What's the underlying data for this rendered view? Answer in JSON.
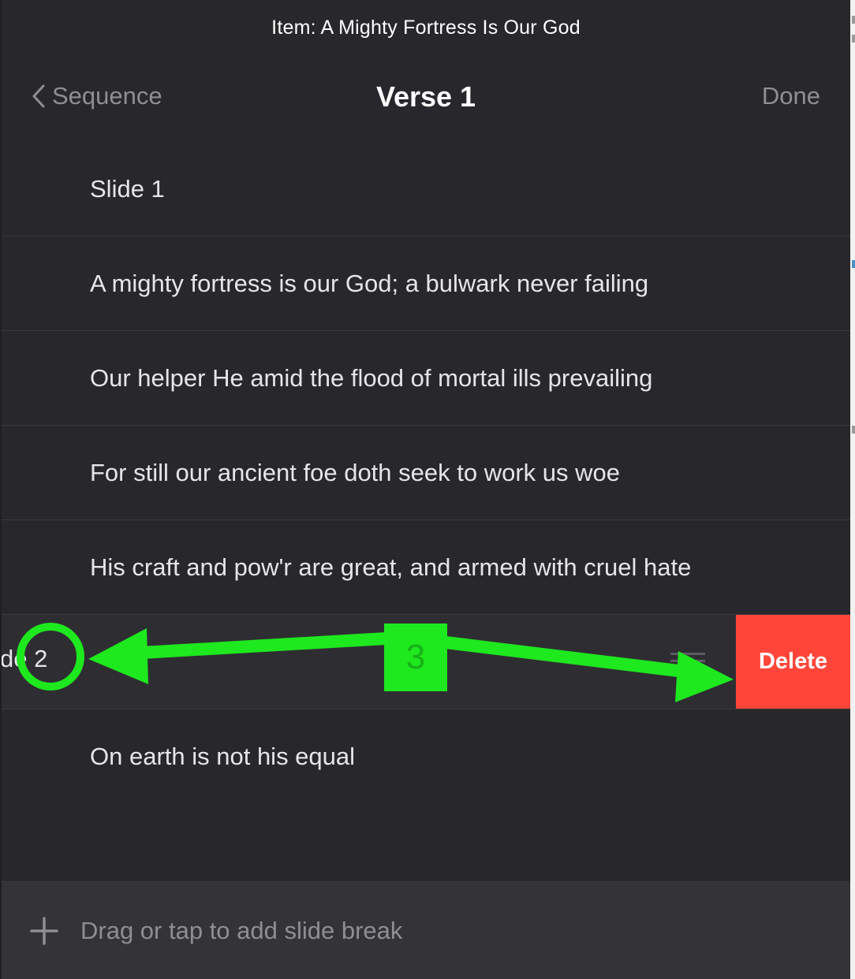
{
  "window": {
    "title": "Item: A Mighty Fortress Is Our God"
  },
  "nav": {
    "back_label": "Sequence",
    "title": "Verse 1",
    "done_label": "Done"
  },
  "rows": [
    {
      "text": "Slide 1"
    },
    {
      "text": "A mighty fortress is our God; a bulwark never failing"
    },
    {
      "text": "Our helper He amid the flood of mortal ills prevailing"
    },
    {
      "text": "For still our ancient foe doth seek to work us woe"
    },
    {
      "text": "His craft and pow'r are great, and armed with cruel hate"
    },
    {
      "text": "de 2",
      "swiped": true,
      "delete_label": "Delete"
    },
    {
      "text": "On earth is not his equal"
    }
  ],
  "bottom_bar": {
    "add_label": "Drag or tap to add slide break",
    "icon": "plus-icon"
  },
  "annotation": {
    "step_number": "3",
    "color": "#1ee81e"
  }
}
